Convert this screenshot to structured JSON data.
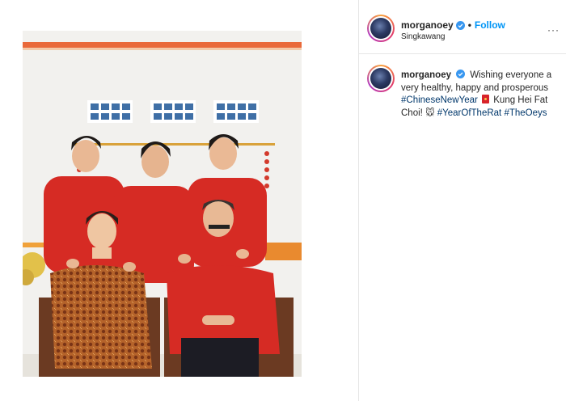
{
  "post": {
    "username": "morganoey",
    "follow_label": "Follow",
    "separator": "•",
    "location": "Singkawang",
    "more": "···",
    "photo_alt": "Family portrait of six people in red outfits"
  },
  "caption": {
    "username": "morganoey",
    "text1": "Wishing everyone a very healthy, happy and prosperous",
    "hashtag1": "#ChineseNewYear",
    "text2": "Kung Hei Fat Choi!",
    "emoji_rat": "🐭",
    "hashtag2": "#YearOfTheRat",
    "hashtag3": "#TheOeys"
  },
  "colors": {
    "accent": "#0095f6",
    "hashtag": "#00376b",
    "shirt_red": "#d62b24"
  }
}
